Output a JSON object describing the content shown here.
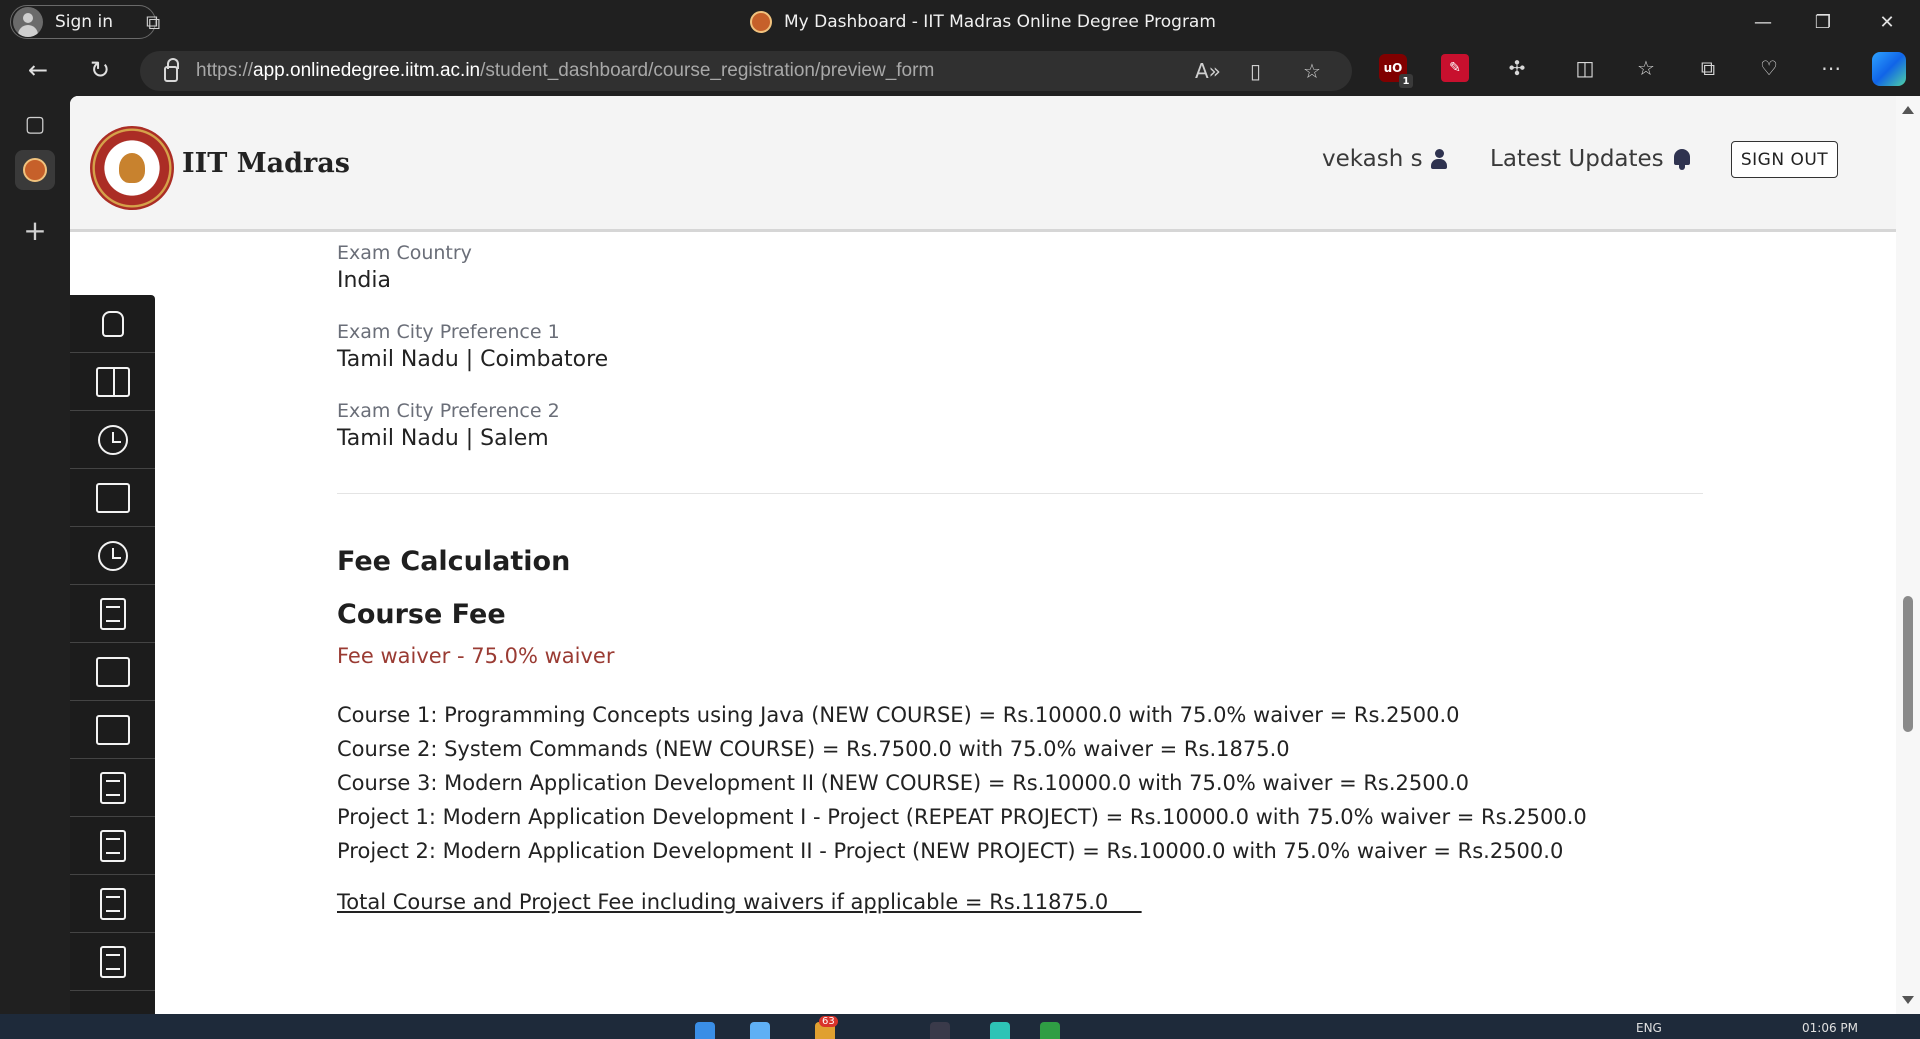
{
  "browser": {
    "signin_label": "Sign in",
    "tab_title": "My Dashboard - IIT Madras Online Degree Program",
    "url_scheme": "https://",
    "url_host": "app.onlinedegree.iitm.ac.in",
    "url_path": "/student_dashboard/course_registration/preview_form",
    "extension_badge": "1",
    "colors": {
      "chrome": "#202020",
      "address_bar": "#303030"
    }
  },
  "header": {
    "brand": "IIT Madras",
    "user": "vekash s",
    "updates": "Latest Updates",
    "signout": "SIGN OUT"
  },
  "exam": [
    {
      "label": "Exam Country",
      "value": "India"
    },
    {
      "label": "Exam City Preference 1",
      "value": "Tamil Nadu | Coimbatore"
    },
    {
      "label": "Exam City Preference 2",
      "value": "Tamil Nadu | Salem"
    }
  ],
  "fee": {
    "heading": "Fee Calculation",
    "subheading": "Course Fee",
    "waiver": "Fee waiver - 75.0% waiver",
    "waiver_color": "#9a3b33",
    "lines": [
      "Course 1: Programming Concepts using Java (NEW COURSE) = Rs.10000.0 with 75.0% waiver = Rs.2500.0",
      "Course 2: System Commands (NEW COURSE) = Rs.7500.0 with 75.0% waiver = Rs.1875.0",
      "Course 3: Modern Application Development II (NEW COURSE) = Rs.10000.0 with 75.0% waiver = Rs.2500.0",
      "Project 1: Modern Application Development I - Project (REPEAT PROJECT) =  Rs.10000.0 with 75.0% waiver = Rs.2500.0",
      "Project 2: Modern Application Development II - Project (NEW PROJECT) = Rs.10000.0 with 75.0% waiver = Rs.2500.0"
    ],
    "total": "Total Course and Project Fee including waivers if applicable = Rs.11875.0     "
  },
  "taskbar": {
    "notification_count": "63",
    "lang": "ENG",
    "time": "01:06 PM"
  }
}
